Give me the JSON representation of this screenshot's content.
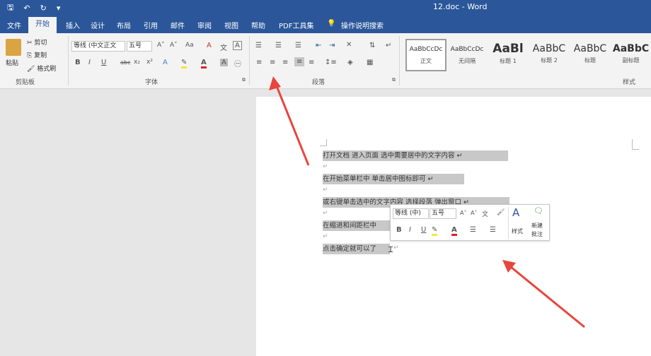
{
  "window": {
    "title": "12.doc - Word"
  },
  "qat": {
    "save": "🖫",
    "undo": "↶",
    "redo": "↻",
    "more": "▾"
  },
  "tabs": [
    "文件",
    "开始",
    "插入",
    "设计",
    "布局",
    "引用",
    "邮件",
    "审阅",
    "视图",
    "帮助",
    "PDF工具集"
  ],
  "tell_me": "操作说明搜索",
  "clipboard": {
    "paste": "粘贴",
    "cut": "剪切",
    "copy": "复制",
    "format_painter": "格式刷",
    "group": "剪贴板"
  },
  "font": {
    "name": "等线 (中文正文",
    "size": "五号",
    "group": "字体",
    "bold": "B",
    "italic": "I",
    "underline": "U",
    "strike": "abc",
    "sub": "x₂",
    "sup": "x²",
    "case": "Aa"
  },
  "paragraph": {
    "group": "段落"
  },
  "styles": {
    "group": "样式",
    "items": [
      {
        "preview": "AaBbCcDc",
        "name": "正文"
      },
      {
        "preview": "AaBbCcDc",
        "name": "无间隔"
      },
      {
        "preview": "AaBl",
        "name": "标题 1"
      },
      {
        "preview": "AaBbC",
        "name": "标题 2"
      },
      {
        "preview": "AaBbC",
        "name": "标题"
      },
      {
        "preview": "AaBbC",
        "name": "副标题"
      }
    ]
  },
  "document": {
    "lines": [
      "打开文档    进入页面   选中需要居中的文字内容  ↵",
      "在开始菜单栏中   单击居中图标即可  ↵",
      "或右键单击选中的文字内容   选择段落   弹出窗口  ↵",
      "在缩进和间距栏中",
      "点击确定就可以了"
    ],
    "para_mark": "↵"
  },
  "mini_toolbar": {
    "font": "等线 (中)",
    "size": "五号",
    "bold": "B",
    "italic": "I",
    "underline": "U",
    "styles": "样式",
    "new_comment_1": "新建",
    "new_comment_2": "批注"
  },
  "annotation_color": "#e8453c"
}
